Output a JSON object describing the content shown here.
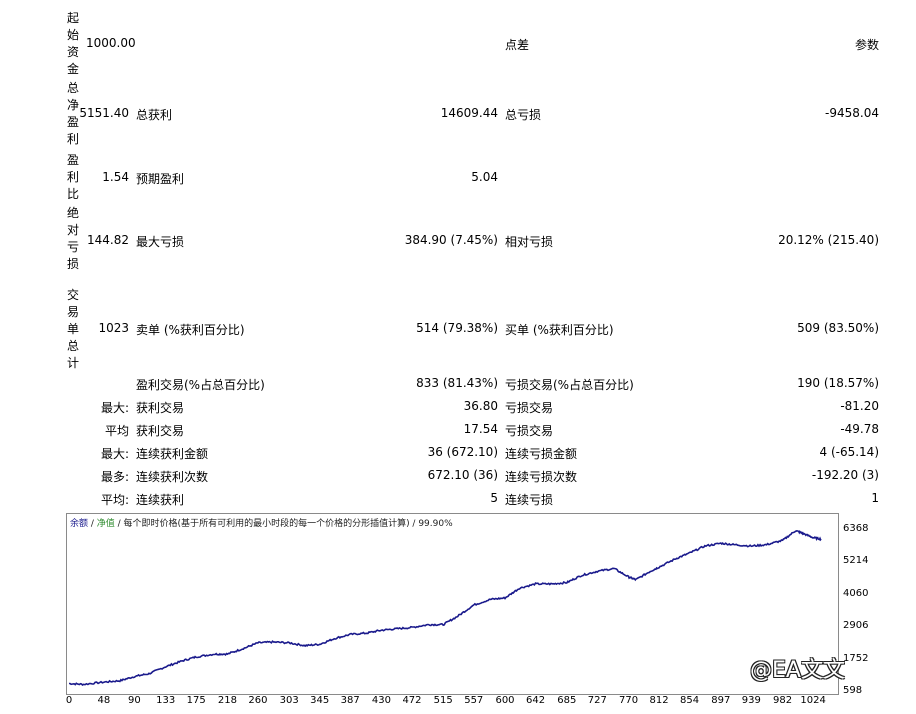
{
  "report": {
    "vertical_labels": [
      "起始资金",
      "总净盈利",
      "盈利比",
      "绝对亏损",
      "交易单总计"
    ],
    "initial_deposit": "1000.00",
    "col2_header": "点差",
    "col3_header": "参数",
    "net_profit": "5151.40",
    "gross_profit_label": "总获利",
    "gross_profit": "14609.44",
    "gross_loss_label": "总亏损",
    "gross_loss": "-9458.04",
    "profit_factor": "1.54",
    "expected_payoff_label": "预期盈利",
    "expected_payoff": "5.04",
    "abs_drawdown": "144.82",
    "max_drawdown_label": "最大亏损",
    "max_drawdown": "384.90 (7.45%)",
    "rel_drawdown_label": "相对亏损",
    "rel_drawdown": "20.12% (215.40)",
    "total_trades": "1023",
    "short_label": "卖单 (%获利百分比)",
    "short_value": "514 (79.38%)",
    "long_label": "买单 (%获利百分比)",
    "long_value": "509 (83.50%)",
    "rows": [
      {
        "prefix": "",
        "l1": "盈利交易(%占总百分比)",
        "v1": "833 (81.43%)",
        "l2": "亏损交易(%占总百分比)",
        "v2": "190 (18.57%)"
      },
      {
        "prefix": "最大:",
        "l1": "获利交易",
        "v1": "36.80",
        "l2": "亏损交易",
        "v2": "-81.20"
      },
      {
        "prefix": "平均",
        "l1": "获利交易",
        "v1": "17.54",
        "l2": "亏损交易",
        "v2": "-49.78"
      },
      {
        "prefix": "最大:",
        "l1": "连续获利金额",
        "v1": "36 (672.10)",
        "l2": "连续亏损金额",
        "v2": "4 (-65.14)"
      },
      {
        "prefix": "最多:",
        "l1": "连续获利次数",
        "v1": "672.10 (36)",
        "l2": "连续亏损次数",
        "v2": "-192.20 (3)"
      },
      {
        "prefix": "平均:",
        "l1": "连续获利",
        "v1": "5",
        "l2": "连续亏损",
        "v2": "1"
      }
    ]
  },
  "chart_legend": {
    "balance": "余额",
    "sep1": " / ",
    "equity": "净值",
    "rest": " / 每个即时价格(基于所有可利用的最小时段的每一个价格的分形插值计算) / 99.90%"
  },
  "colors": {
    "balance_line": "#1a1a8c",
    "legend_balance": "#1a1a8c",
    "legend_equity": "#2e8b2e"
  },
  "watermark": "@EA文文",
  "chart_data": {
    "type": "line",
    "title": "",
    "xlabel": "",
    "ylabel": "",
    "x_ticks": [
      0,
      48,
      90,
      133,
      175,
      218,
      260,
      303,
      345,
      387,
      430,
      472,
      515,
      557,
      600,
      642,
      685,
      727,
      770,
      812,
      854,
      897,
      939,
      982,
      1024
    ],
    "y_ticks": [
      598,
      1752,
      2906,
      4060,
      5214,
      6368
    ],
    "xlim": [
      0,
      1050
    ],
    "ylim": [
      598,
      6800
    ],
    "series": [
      {
        "name": "",
        "x": [
          0,
          20,
          48,
          70,
          90,
          110,
          133,
          155,
          175,
          200,
          218,
          240,
          260,
          280,
          303,
          325,
          345,
          365,
          387,
          410,
          430,
          450,
          472,
          495,
          515,
          535,
          557,
          580,
          600,
          620,
          642,
          665,
          685,
          705,
          727,
          750,
          770,
          780,
          800,
          812,
          835,
          854,
          875,
          897,
          915,
          939,
          960,
          982,
          1000,
          1010,
          1024,
          1035
        ],
        "y": [
          900,
          870,
          950,
          1000,
          1150,
          1250,
          1500,
          1700,
          1850,
          1950,
          1950,
          2150,
          2350,
          2380,
          2350,
          2250,
          2300,
          2500,
          2650,
          2700,
          2800,
          2850,
          2900,
          3000,
          3000,
          3300,
          3700,
          3900,
          3950,
          4300,
          4450,
          4450,
          4500,
          4750,
          4900,
          5000,
          4700,
          4600,
          4900,
          5050,
          5350,
          5550,
          5800,
          5900,
          5850,
          5800,
          5850,
          6000,
          6350,
          6250,
          6100,
          6050
        ]
      }
    ]
  }
}
